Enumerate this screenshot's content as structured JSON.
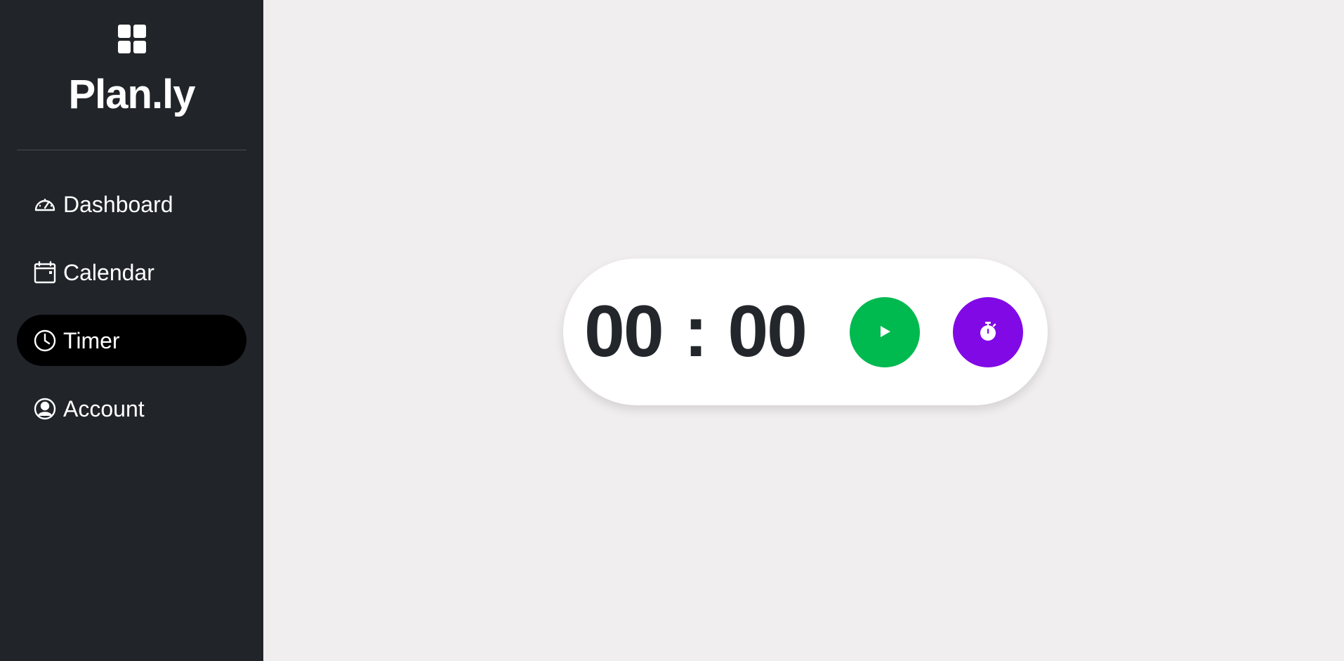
{
  "app": {
    "brand_name": "Plan.ly",
    "brand_icon": "grid-icon"
  },
  "sidebar": {
    "items": [
      {
        "label": "Dashboard",
        "icon": "speedometer-icon",
        "active": false
      },
      {
        "label": "Calendar",
        "icon": "calendar-icon",
        "active": false
      },
      {
        "label": "Timer",
        "icon": "clock-icon",
        "active": true
      },
      {
        "label": "Account",
        "icon": "user-circle-icon",
        "active": false
      }
    ]
  },
  "timer": {
    "minutes": "00",
    "separator": ":",
    "seconds": "00",
    "play_icon": "play-icon",
    "stopwatch_icon": "stopwatch-icon"
  },
  "colors": {
    "sidebar_bg": "#212429",
    "page_bg": "#f0eeef",
    "active_nav_bg": "#000000",
    "play_button": "#00b94f",
    "stopwatch_button": "#8109e6",
    "time_text": "#23262b"
  }
}
